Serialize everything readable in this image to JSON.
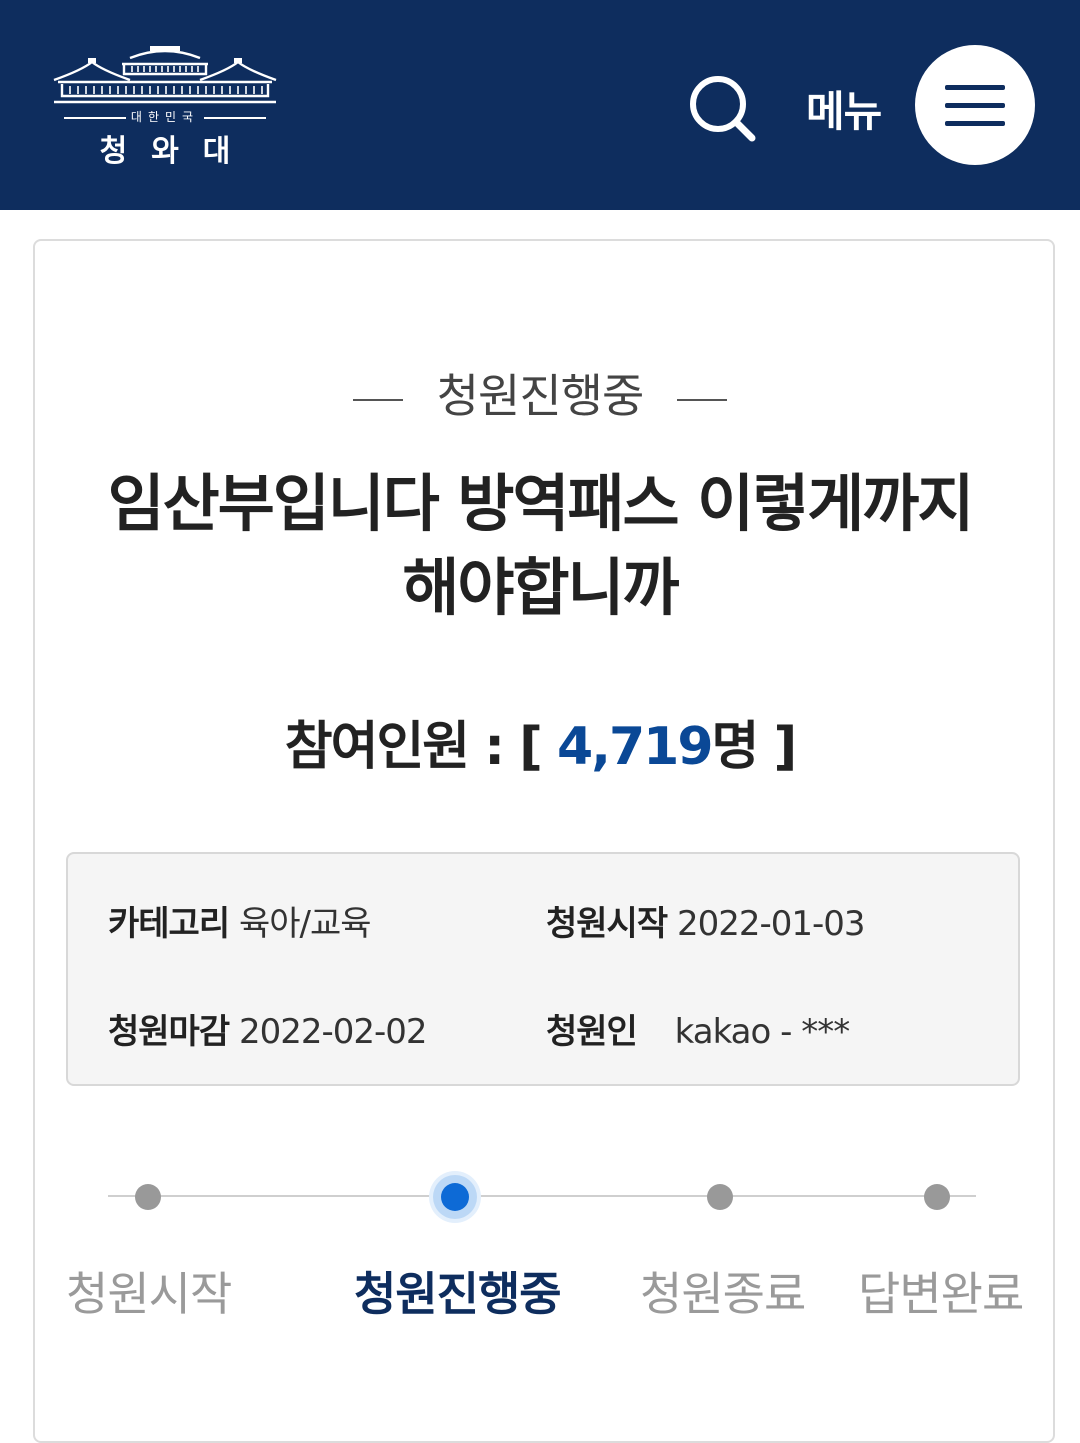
{
  "header": {
    "logo_small": "대한민국",
    "logo_big": "청와대",
    "menu_label": "메뉴",
    "search_icon": "search-icon",
    "menu_icon": "hamburger-icon",
    "background_color": "#0e2d5e"
  },
  "petition": {
    "status": "청원진행중",
    "title": "임산부입니다 방역패스 이렇게까지 해야합니까",
    "participants_label": "참여인원 : [",
    "participants_count": "4,719",
    "participants_unit": "명 ]",
    "count_color": "#0a4896"
  },
  "info": {
    "category_label": "카테고리",
    "category_value": "육아/교육",
    "start_label": "청원시작",
    "start_value": "2022-01-03",
    "end_label": "청원마감",
    "end_value": "2022-02-02",
    "author_label": "청원인",
    "author_value": "kakao - ***"
  },
  "progress": {
    "steps": [
      {
        "label": "청원시작",
        "active": false
      },
      {
        "label": "청원진행중",
        "active": true
      },
      {
        "label": "청원종료",
        "active": false
      },
      {
        "label": "답변완료",
        "active": false
      }
    ],
    "active_color": "#0d6ad6"
  }
}
